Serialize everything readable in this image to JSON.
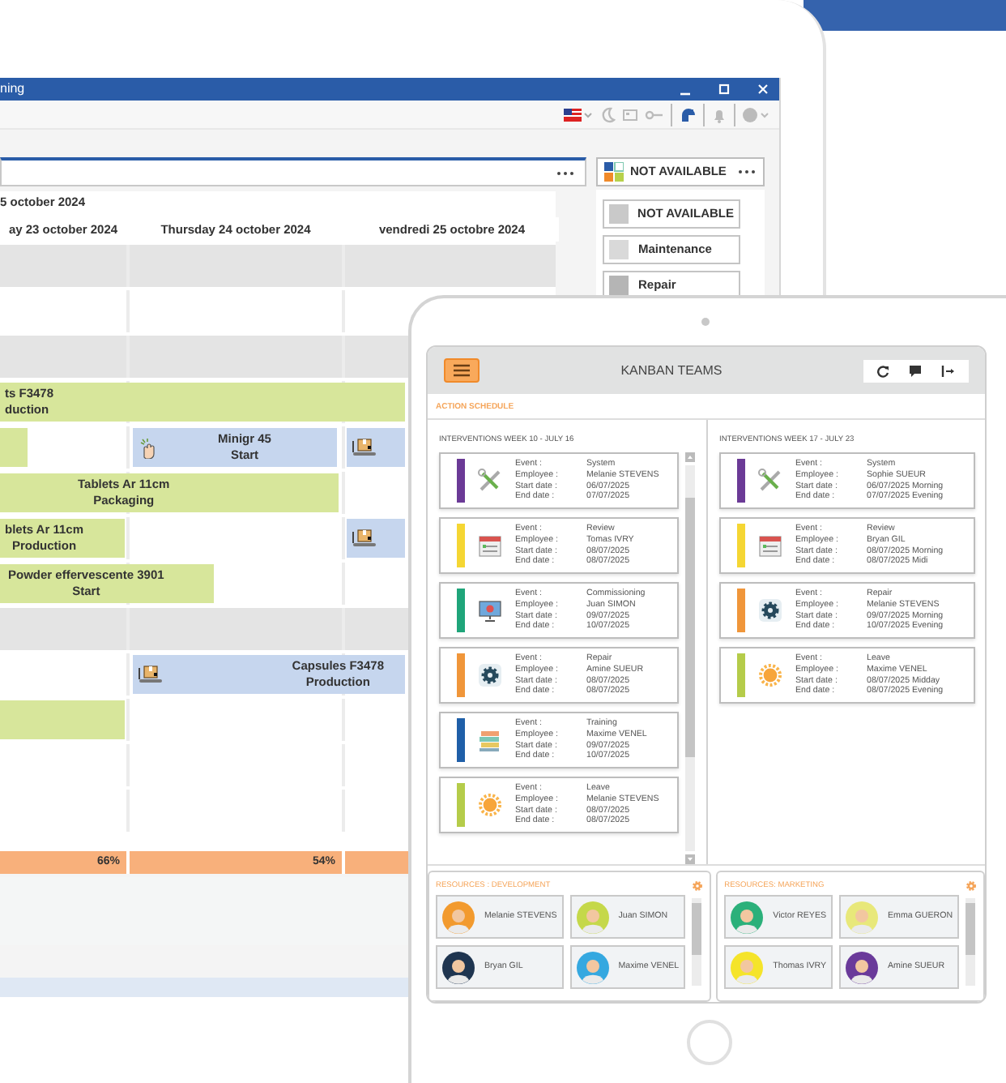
{
  "laptop": {
    "window_title": "ning",
    "resource_picker": {
      "label": "NOT AVAILABLE"
    },
    "legend": [
      {
        "label": "NOT AVAILABLE",
        "color": "#c9c9c9"
      },
      {
        "label": "Maintenance",
        "color": "#d9d9d9"
      },
      {
        "label": "Repair",
        "color": "#b5b5b5"
      }
    ],
    "planner": {
      "date_header": "5 october 2024",
      "days": [
        "ay 23 october 2024",
        "Thursday 24 october 2024",
        "vendredi 25 octobre 2024"
      ],
      "rows": [
        {
          "kind": "group",
          "bars": []
        },
        {
          "kind": "line",
          "bars": []
        },
        {
          "kind": "group",
          "bars": []
        },
        {
          "kind": "line",
          "bars": [
            {
              "color": "#d7e69b",
              "kind": "plain",
              "name": "ts F3478",
              "step": "duction"
            }
          ]
        },
        {
          "kind": "line",
          "bars": [
            {
              "color": "#d7e69b",
              "kind": "plain"
            },
            {
              "color": "#c6d6ee",
              "kind": "hand",
              "name": "Minigr 45",
              "step": "Start"
            },
            {
              "color": "#c6d6ee",
              "kind": "conveyor"
            }
          ]
        },
        {
          "kind": "line",
          "bars": [
            {
              "color": "#d7e69b",
              "kind": "plain",
              "name": "Tablets  Ar 11cm",
              "step": "Packaging"
            }
          ]
        },
        {
          "kind": "line",
          "bars": [
            {
              "color": "#d7e69b",
              "kind": "plain",
              "name": "blets  Ar 11cm",
              "step": "Production"
            },
            {
              "color": "#c6d6ee",
              "kind": "conveyor"
            }
          ]
        },
        {
          "kind": "line",
          "bars": [
            {
              "color": "#d7e69b",
              "kind": "plain",
              "name": "Powder effervescente 3901",
              "step": "Start"
            }
          ]
        },
        {
          "kind": "group",
          "bars": []
        },
        {
          "kind": "line",
          "bars": [
            {
              "color": "#c6d6ee",
              "kind": "conveyor",
              "name": "Capsules F3478",
              "step": "Production"
            }
          ]
        },
        {
          "kind": "line",
          "bars": [
            {
              "color": "#d7e69b",
              "kind": "plain"
            }
          ]
        },
        {
          "kind": "line",
          "bars": []
        },
        {
          "kind": "line",
          "bars": []
        }
      ],
      "load": [
        "66%",
        "54%"
      ]
    }
  },
  "tablet": {
    "title": "KANBAN TEAMS",
    "section": "ACTION SCHEDULE",
    "weeks": [
      {
        "title": "INTERVENTIONS WEEK 10 - JULY 16",
        "cards": [
          {
            "color": "#6b3a96",
            "kind": "tools",
            "fields": [
              {
                "label": "Event :",
                "value": "System"
              },
              {
                "label": "Employee :",
                "value": "Melanie STEVENS"
              },
              {
                "label": "Start date :",
                "value": "06/07/2025"
              },
              {
                "label": "End date :",
                "value": "07/07/2025"
              }
            ]
          },
          {
            "color": "#f5d633",
            "kind": "calendar",
            "fields": [
              {
                "label": "Event :",
                "value": "Review"
              },
              {
                "label": "Employee :",
                "value": "Tomas IVRY"
              },
              {
                "label": "Start date :",
                "value": "08/07/2025"
              },
              {
                "label": "End date :",
                "value": "08/07/2025"
              }
            ]
          },
          {
            "color": "#1fa57a",
            "kind": "monitor",
            "fields": [
              {
                "label": "Event :",
                "value": "Commissioning"
              },
              {
                "label": "Employee :",
                "value": "Juan SIMON"
              },
              {
                "label": "Start date :",
                "value": "09/07/2025"
              },
              {
                "label": "End date :",
                "value": "10/07/2025"
              }
            ]
          },
          {
            "color": "#f0963a",
            "kind": "gear",
            "fields": [
              {
                "label": "Event :",
                "value": "Repair"
              },
              {
                "label": "Employee :",
                "value": "Amine SUEUR"
              },
              {
                "label": "Start date :",
                "value": "08/07/2025"
              },
              {
                "label": "End date :",
                "value": "08/07/2025"
              }
            ]
          },
          {
            "color": "#1f5fa8",
            "kind": "books",
            "fields": [
              {
                "label": "Event :",
                "value": "Training"
              },
              {
                "label": "Employee :",
                "value": "Maxime VENEL"
              },
              {
                "label": "Start date :",
                "value": "09/07/2025"
              },
              {
                "label": "End date :",
                "value": "10/07/2025"
              }
            ]
          },
          {
            "color": "#b5cc4a",
            "kind": "sun",
            "fields": [
              {
                "label": "Event :",
                "value": "Leave"
              },
              {
                "label": "Employee :",
                "value": "Melanie STEVENS"
              },
              {
                "label": "Start date :",
                "value": "08/07/2025"
              },
              {
                "label": "End date :",
                "value": "08/07/2025"
              }
            ]
          }
        ]
      },
      {
        "title": "INTERVENTIONS WEEK 17 - JULY 23",
        "cards": [
          {
            "color": "#6b3a96",
            "kind": "tools",
            "fields": [
              {
                "label": "Event :",
                "value": "System"
              },
              {
                "label": "Employee :",
                "value": "Sophie SUEUR"
              },
              {
                "label": "Start date :",
                "value": "06/07/2025 Morning"
              },
              {
                "label": "End date :",
                "value": "07/07/2025 Evening"
              }
            ]
          },
          {
            "color": "#f5d633",
            "kind": "calendar",
            "fields": [
              {
                "label": "Event :",
                "value": "Review"
              },
              {
                "label": "Employee :",
                "value": "Bryan GIL"
              },
              {
                "label": "Start date :",
                "value": "08/07/2025 Morning"
              },
              {
                "label": "End date :",
                "value": "08/07/2025 Midi"
              }
            ]
          },
          {
            "color": "#f0963a",
            "kind": "gear",
            "fields": [
              {
                "label": "Event :",
                "value": "Repair"
              },
              {
                "label": "Employee :",
                "value": "Melanie STEVENS"
              },
              {
                "label": "Start date :",
                "value": "09/07/2025 Morning"
              },
              {
                "label": "End date :",
                "value": "10/07/2025 Evening"
              }
            ]
          },
          {
            "color": "#b5cc4a",
            "kind": "sun",
            "fields": [
              {
                "label": "Event :",
                "value": "Leave"
              },
              {
                "label": "Employee :",
                "value": "Maxime VENEL"
              },
              {
                "label": "Start date :",
                "value": "08/07/2025 Midday"
              },
              {
                "label": "End date :",
                "value": "08/07/2025 Evening"
              }
            ]
          }
        ]
      }
    ],
    "resource_panels": [
      {
        "title": "RESOURCES : DEVELOPMENT",
        "people": [
          {
            "name": "Melanie STEVENS",
            "color": "#f29a2e"
          },
          {
            "name": "Juan SIMON",
            "color": "#c5d84a"
          },
          {
            "name": "Bryan GIL",
            "color": "#1f3550"
          },
          {
            "name": "Maxime VENEL",
            "color": "#35a8e0"
          }
        ]
      },
      {
        "title": "RESOURCES: MARKETING",
        "people": [
          {
            "name": "Victor REYES",
            "color": "#2bb07a"
          },
          {
            "name": "Emma GUERON",
            "color": "#e8e87a"
          },
          {
            "name": "Thomas IVRY",
            "color": "#f5e42a"
          },
          {
            "name": "Amine SUEUR",
            "color": "#6a3a9a"
          }
        ]
      }
    ]
  }
}
